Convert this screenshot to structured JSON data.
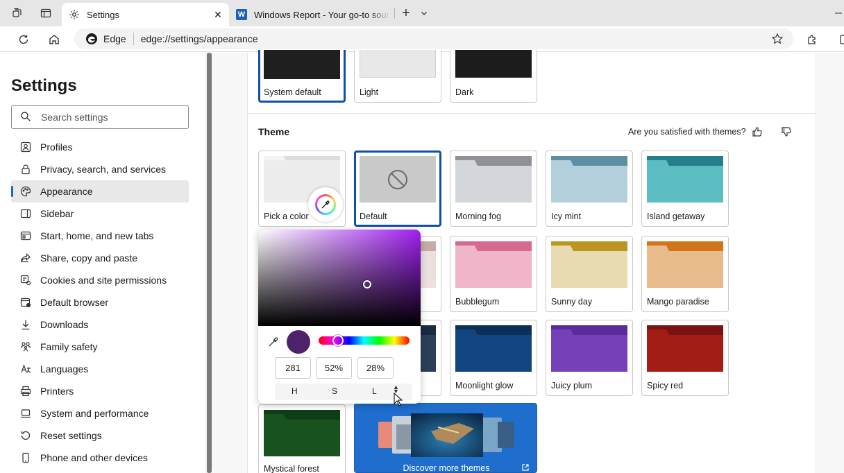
{
  "browser": {
    "tabs": [
      {
        "title": "Settings",
        "icon": "gear-icon",
        "active": true
      },
      {
        "title": "Windows Report - Your go-to source",
        "icon": "windows-report-icon",
        "active": false
      }
    ],
    "address": {
      "brand": "Edge",
      "url": "edge://settings/appearance"
    }
  },
  "sidebar": {
    "title": "Settings",
    "search_placeholder": "Search settings",
    "items": [
      {
        "label": "Profiles",
        "icon": "profile-icon"
      },
      {
        "label": "Privacy, search, and services",
        "icon": "lock-icon"
      },
      {
        "label": "Appearance",
        "icon": "palette-icon",
        "selected": true
      },
      {
        "label": "Sidebar",
        "icon": "sidebar-icon"
      },
      {
        "label": "Start, home, and new tabs",
        "icon": "home-tabs-icon"
      },
      {
        "label": "Share, copy and paste",
        "icon": "share-icon"
      },
      {
        "label": "Cookies and site permissions",
        "icon": "cookies-icon"
      },
      {
        "label": "Default browser",
        "icon": "browser-icon"
      },
      {
        "label": "Downloads",
        "icon": "download-icon"
      },
      {
        "label": "Family safety",
        "icon": "family-icon"
      },
      {
        "label": "Languages",
        "icon": "language-icon"
      },
      {
        "label": "Printers",
        "icon": "printer-icon"
      },
      {
        "label": "System and performance",
        "icon": "laptop-icon"
      },
      {
        "label": "Reset settings",
        "icon": "reset-icon"
      },
      {
        "label": "Phone and other devices",
        "icon": "phone-icon"
      }
    ]
  },
  "appearance": {
    "options": [
      {
        "label": "System default",
        "selected": true
      },
      {
        "label": "Light"
      },
      {
        "label": "Dark"
      }
    ]
  },
  "theme": {
    "heading": "Theme",
    "feedback_question": "Are you satisfied with themes?",
    "tiles": [
      {
        "label": "Pick a color",
        "tab": "#f2f2f2",
        "body": "#e8e8e8"
      },
      {
        "label": "Default",
        "tab": "#c9c9c9",
        "body": "#c9c9c9",
        "selected": true
      },
      {
        "label": "Morning fog",
        "tab": "#8e9195",
        "body": "#d3d6da"
      },
      {
        "label": "Icy mint",
        "tab": "#5d8fa3",
        "body": "#b3cfdb"
      },
      {
        "label": "Island getaway",
        "tab": "#237f8a",
        "body": "#5bbcc2"
      },
      {
        "label": "Bubblegum",
        "tab": "#d66a8d",
        "body": "#eeb6c8"
      },
      {
        "label": "Sunny day",
        "tab": "#bb951f",
        "body": "#e8dbb1"
      },
      {
        "label": "Mango paradise",
        "tab": "#d0751b",
        "body": "#e8bb8c"
      },
      {
        "label": "Moonlight glow",
        "tab": "#0c2e5a",
        "body": "#12457f"
      },
      {
        "label": "Juicy plum",
        "tab": "#5b2b9c",
        "body": "#7441b8"
      },
      {
        "label": "Spicy red",
        "tab": "#7a1212",
        "body": "#a31c16"
      },
      {
        "label": "Mystical forest",
        "tab": "#0e3e17",
        "body": "#18531f"
      }
    ],
    "discover_label": "Discover more themes"
  },
  "color_picker": {
    "hue": "281",
    "saturation": "52%",
    "lightness": "28%",
    "labels": [
      "H",
      "S",
      "L"
    ],
    "swatch_color": "#4e2268"
  }
}
